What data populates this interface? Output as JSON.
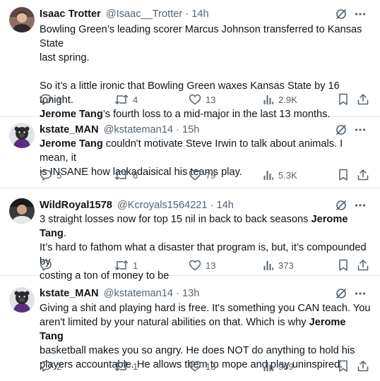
{
  "tweets": [
    {
      "name": "Isaac Trotter",
      "handle": "@Isaac__Trotter",
      "sep": "·",
      "time": "14h",
      "lines": [
        [
          "Bowling Green’s leading scorer Marcus Johnson transferred to Kansas State"
        ],
        [
          "last spring."
        ],
        [],
        [
          "So it’s a little ironic that Bowling Green waxes Kansas State by 16 tonight."
        ],
        [
          {
            "b": "Jerome Tang"
          },
          "’s fourth loss to a mid-major in the last 13 months."
        ]
      ],
      "replies": "1",
      "retweets": "4",
      "likes": "13",
      "views": "2.9K"
    },
    {
      "name": "kstate_MAN",
      "handle": "@kstateman14",
      "sep": "·",
      "time": "15h",
      "lines": [
        [
          {
            "b": "Jerome Tang"
          },
          " couldn't motivate Steve Irwin to talk about animals. I mean, it"
        ],
        [
          "is INSANE how lackadaisical his teams play."
        ]
      ],
      "replies": "5",
      "retweets": "6",
      "likes": "79",
      "views": "5.3K"
    },
    {
      "name": "WildRoyal1578",
      "handle": "@Kcroyals1564221",
      "sep": "·",
      "time": "14h",
      "lines": [
        [
          "3 straight losses now for top 15 nil in back to back seasons ",
          {
            "b": "Jerome Tang"
          },
          "."
        ],
        [
          "It’s hard to fathom what a disaster that program is, but, it’s compounded by"
        ],
        [
          "costing a ton of money to be"
        ]
      ],
      "replies": "",
      "retweets": "1",
      "likes": "13",
      "views": "373"
    },
    {
      "name": "kstate_MAN",
      "handle": "@kstateman14",
      "sep": "·",
      "time": "13h",
      "lines": [
        [
          "Giving a shit and playing hard is free. It's something you CAN teach. You"
        ],
        [
          "aren't limited by your natural abilities on that. Which is why ",
          {
            "b": "Jerome Tang"
          }
        ],
        [
          "basketball makes you so angry. He does NOT do anything to hold his"
        ],
        [
          "players accountable. He allows them to mope and play uninspired."
        ]
      ],
      "replies": "2",
      "retweets": "1",
      "likes": "13",
      "views": "969"
    }
  ],
  "colors": {
    "text": "#0f1419",
    "secondary": "#536471",
    "divider": "#e6e9ec"
  },
  "icons": [
    "grok-icon",
    "more-icon",
    "reply-icon",
    "retweet-icon",
    "like-icon",
    "views-icon",
    "bookmark-icon",
    "share-icon"
  ]
}
